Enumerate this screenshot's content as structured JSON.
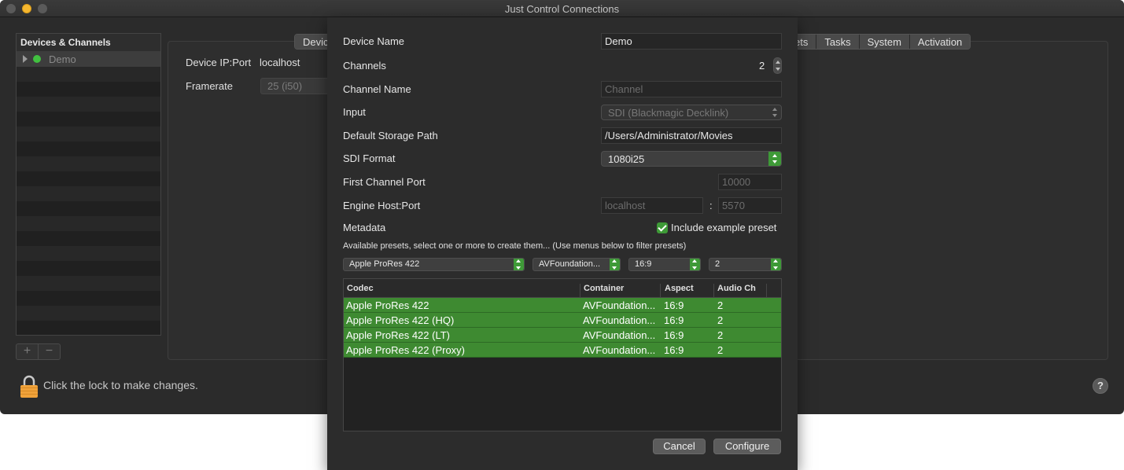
{
  "window": {
    "title": "Just Control Connections"
  },
  "sidebar": {
    "header": "Devices & Channels",
    "items": [
      {
        "label": "Demo",
        "status_color": "#41c040"
      }
    ]
  },
  "toolbar": {
    "add_label": "+",
    "remove_label": "−"
  },
  "tabs": {
    "left": [
      "Devic"
    ],
    "right": [
      "ets",
      "Tasks",
      "System",
      "Activation"
    ]
  },
  "device": {
    "ip_label": "Device IP:Port",
    "ip_value": "localhost",
    "framerate_label": "Framerate",
    "framerate_value": "25 (i50)"
  },
  "footer": {
    "lock_text": "Click the lock to make changes.",
    "help_label": "?"
  },
  "sheet": {
    "device_name_label": "Device Name",
    "device_name_value": "Demo",
    "channels_label": "Channels",
    "channels_value": "2",
    "channel_name_label": "Channel Name",
    "channel_name_placeholder": "Channel",
    "input_label": "Input",
    "input_value": "SDI (Blackmagic Decklink)",
    "storage_label": "Default Storage Path",
    "storage_value": "/Users/Administrator/Movies",
    "sdi_label": "SDI Format",
    "sdi_value": "1080i25",
    "first_port_label": "First Channel Port",
    "first_port_placeholder": "10000",
    "engine_label": "Engine Host:Port",
    "engine_host_placeholder": "localhost",
    "engine_separator": ":",
    "engine_port_placeholder": "5570",
    "metadata_label": "Metadata",
    "include_preset_label": "Include example preset",
    "include_preset_checked": true,
    "presets_hint": "Available presets, select one or more to create them... (Use menus below to filter presets)",
    "filters": {
      "codec": "Apple ProRes 422",
      "container": "AVFoundation...",
      "aspect": "16:9",
      "audio": "2"
    },
    "table": {
      "columns": [
        "Codec",
        "Container",
        "Aspect",
        "Audio Ch"
      ],
      "rows": [
        [
          "Apple ProRes 422",
          "AVFoundation...",
          "16:9",
          "2"
        ],
        [
          "Apple ProRes 422 (HQ)",
          "AVFoundation...",
          "16:9",
          "2"
        ],
        [
          "Apple ProRes 422 (LT)",
          "AVFoundation...",
          "16:9",
          "2"
        ],
        [
          "Apple ProRes 422 (Proxy)",
          "AVFoundation...",
          "16:9",
          "2"
        ]
      ],
      "selection_color": "#3e8a31"
    },
    "cancel_label": "Cancel",
    "configure_label": "Configure"
  }
}
